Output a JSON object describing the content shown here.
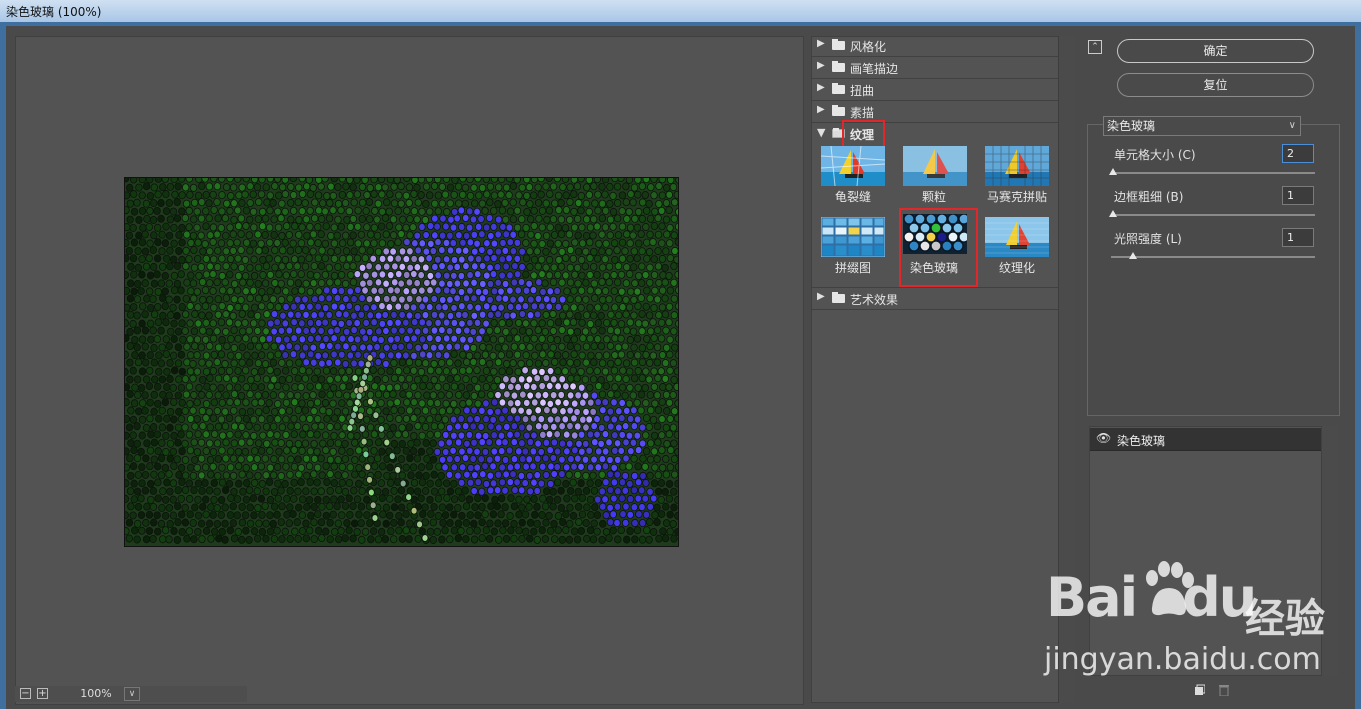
{
  "window": {
    "title": "染色玻璃 (100%)"
  },
  "preview": {
    "zoom_out": "−",
    "zoom_in": "+",
    "zoom_level": "100%"
  },
  "gallery": {
    "categories": [
      {
        "label": "风格化",
        "expanded": false
      },
      {
        "label": "画笔描边",
        "expanded": false
      },
      {
        "label": "扭曲",
        "expanded": false
      },
      {
        "label": "素描",
        "expanded": false
      },
      {
        "label": "纹理",
        "expanded": true
      },
      {
        "label": "艺术效果",
        "expanded": false
      }
    ],
    "thumbnails": [
      {
        "label": "龟裂缝",
        "selected": false
      },
      {
        "label": "颗粒",
        "selected": false
      },
      {
        "label": "马赛克拼贴",
        "selected": false
      },
      {
        "label": "拼缀图",
        "selected": false
      },
      {
        "label": "染色玻璃",
        "selected": true
      },
      {
        "label": "纹理化",
        "selected": false
      }
    ]
  },
  "actions": {
    "ok_label": "确定",
    "reset_label": "复位",
    "collapse_icon": "collapse-up-icon"
  },
  "settings": {
    "filter_name": "染色玻璃",
    "params": [
      {
        "label": "单元格大小 (C)",
        "value": "2",
        "slider_fraction": 0.01
      },
      {
        "label": "边框粗细 (B)",
        "value": "1",
        "slider_fraction": 0.01
      },
      {
        "label": "光照强度 (L)",
        "value": "1",
        "slider_fraction": 0.1
      }
    ]
  },
  "layers": {
    "items": [
      {
        "name": "染色玻璃",
        "visible": true
      }
    ]
  },
  "watermark": {
    "brand": "Bai",
    "brand2": "du",
    "suffix": "经验",
    "url": "jingyan.baidu.com"
  },
  "colors": {
    "accent_red": "#e0282a",
    "panel_bg": "#535353",
    "dialog_bg": "#4a4a4a"
  }
}
